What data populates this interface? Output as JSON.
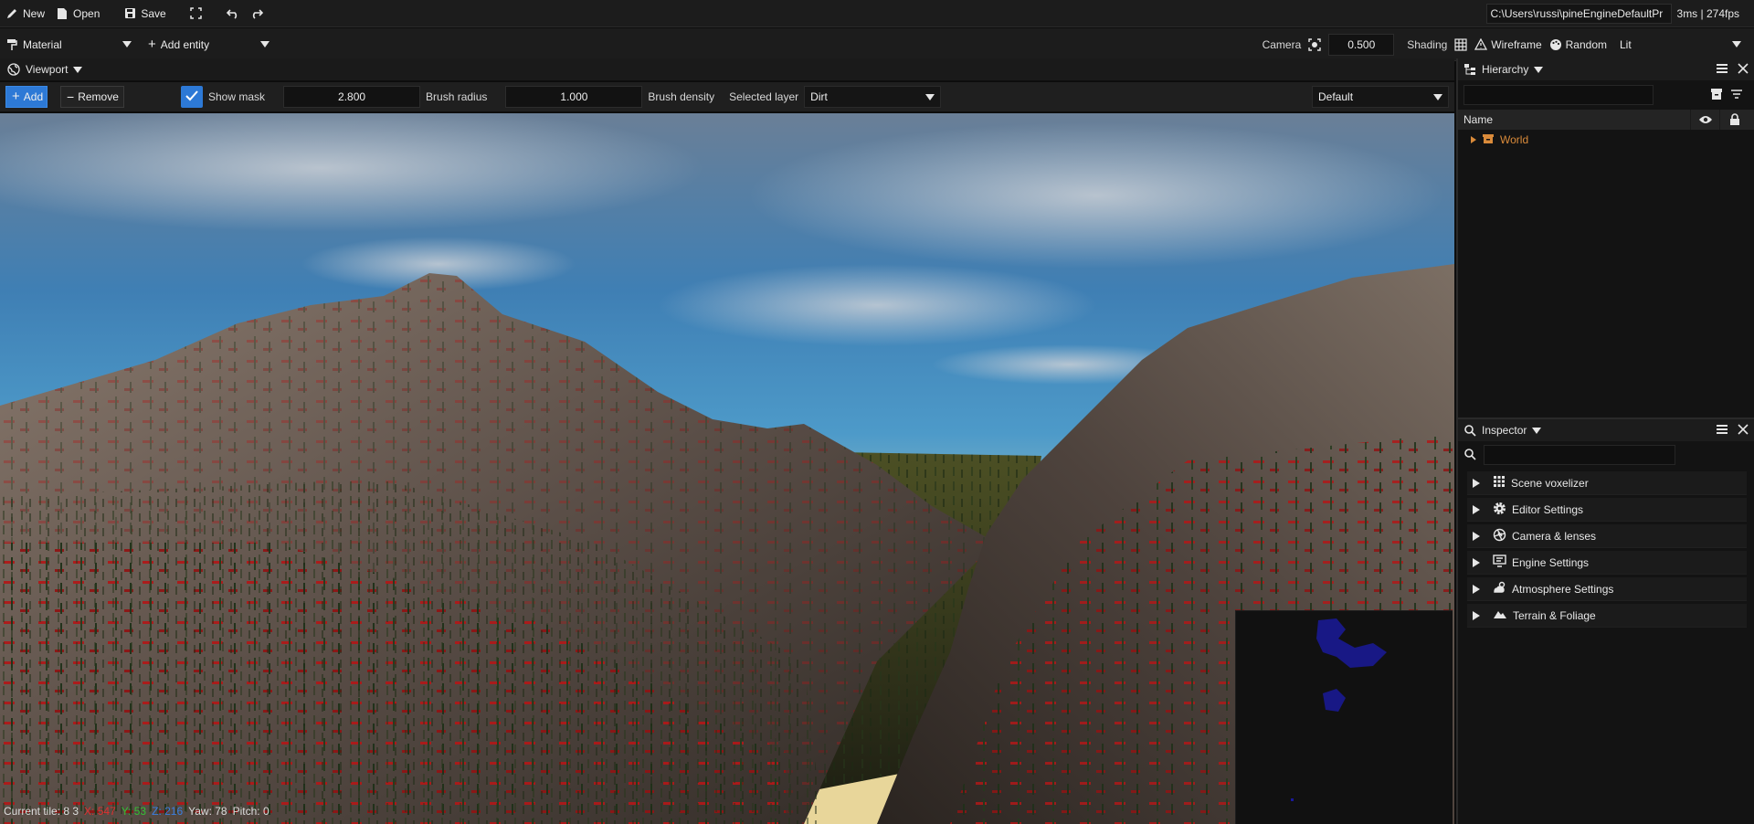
{
  "menubar": {
    "new_label": "New",
    "open_label": "Open",
    "save_label": "Save",
    "project_path": "C:\\Users\\russi\\pineEngineDefaultPr",
    "perf": "3ms | 274fps"
  },
  "toolbar2": {
    "mode_label": "Material",
    "add_entity_label": "Add entity",
    "camera_label": "Camera",
    "camera_value": "0.500",
    "shading_label": "Shading",
    "wireframe_label": "Wireframe",
    "random_label": "Random",
    "lit_label": "Lit"
  },
  "viewport": {
    "tab_label": "Viewport",
    "add_label": "Add",
    "remove_label": "Remove",
    "show_mask_label": "Show mask",
    "show_mask_checked": true,
    "brush_radius_value": "2.800",
    "brush_radius_label": "Brush radius",
    "brush_density_value": "1.000",
    "brush_density_label": "Brush density",
    "selected_layer_label": "Selected layer",
    "selected_layer_value": "Dirt",
    "preset_value": "Default",
    "status": {
      "tile": "Current tile: 8 3",
      "x": "X: 547",
      "y": "Y: 53",
      "z": "Z: 216",
      "yaw": "Yaw: 78",
      "pitch": "Pitch: 0"
    }
  },
  "hierarchy": {
    "title": "Hierarchy",
    "column_name": "Name",
    "items": [
      {
        "label": "World"
      }
    ]
  },
  "inspector": {
    "title": "Inspector",
    "sections": [
      {
        "label": "Scene voxelizer",
        "icon": "grid-icon"
      },
      {
        "label": "Editor Settings",
        "icon": "gear-icon"
      },
      {
        "label": "Camera & lenses",
        "icon": "aperture-icon"
      },
      {
        "label": "Engine Settings",
        "icon": "monitor-icon"
      },
      {
        "label": "Atmosphere Settings",
        "icon": "weather-icon"
      },
      {
        "label": "Terrain & Foliage",
        "icon": "mountain-icon"
      }
    ]
  },
  "colors": {
    "accent": "#2d79d6",
    "world_item": "#d98a3a",
    "x_axis": "#e03030",
    "y_axis": "#34c034",
    "z_axis": "#3a7fe0"
  }
}
